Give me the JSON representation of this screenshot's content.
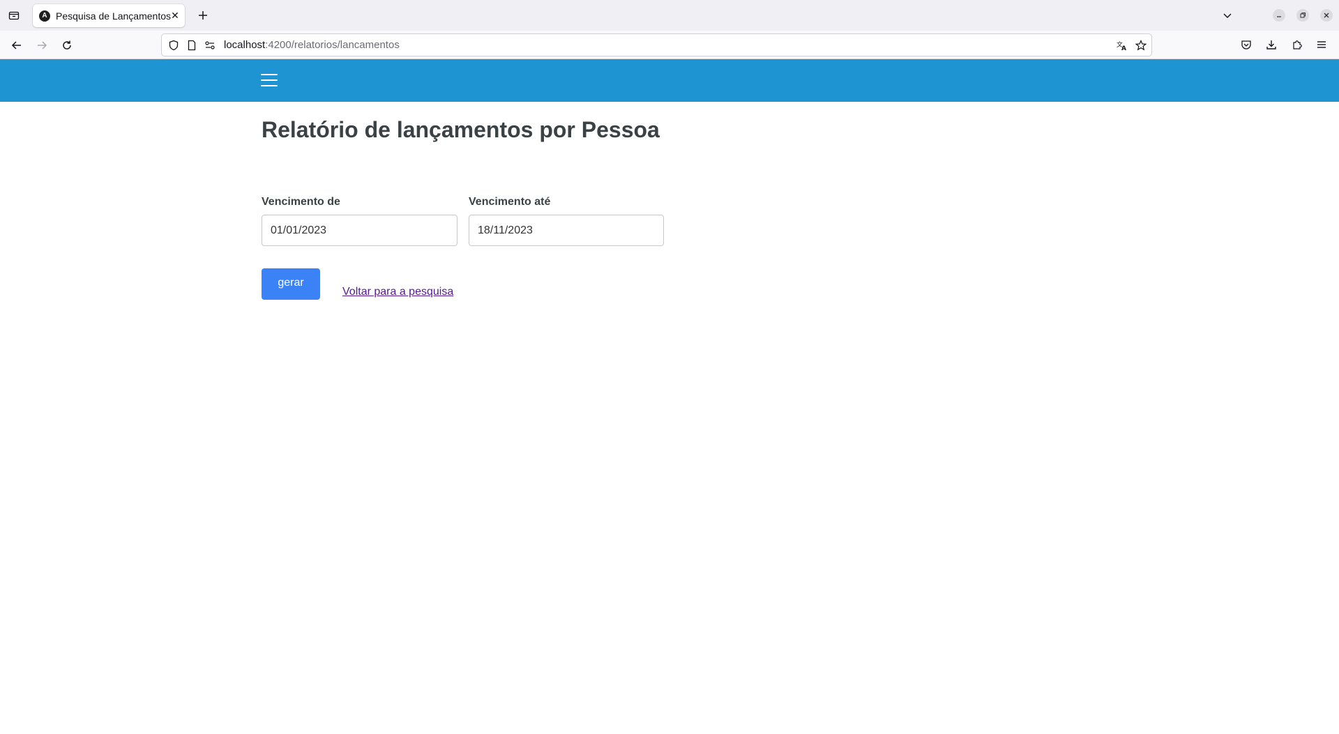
{
  "browser": {
    "tab": {
      "title": "Pesquisa de Lançamentos",
      "favicon_icon": "angular-icon"
    },
    "url": {
      "host": "localhost",
      "path": ":4200/relatorios/lancamentos"
    }
  },
  "page": {
    "title": "Relatório de lançamentos por Pessoa",
    "form": {
      "vencimento_de": {
        "label": "Vencimento de",
        "value": "01/01/2023"
      },
      "vencimento_ate": {
        "label": "Vencimento até",
        "value": "18/11/2023"
      }
    },
    "actions": {
      "gerar_label": "gerar",
      "voltar_label": "Voltar para a pesquisa"
    }
  },
  "colors": {
    "header": "#1e94d3",
    "primary_button": "#3b82f6",
    "visited_link": "#551a8b",
    "title_text": "#3b4246"
  }
}
